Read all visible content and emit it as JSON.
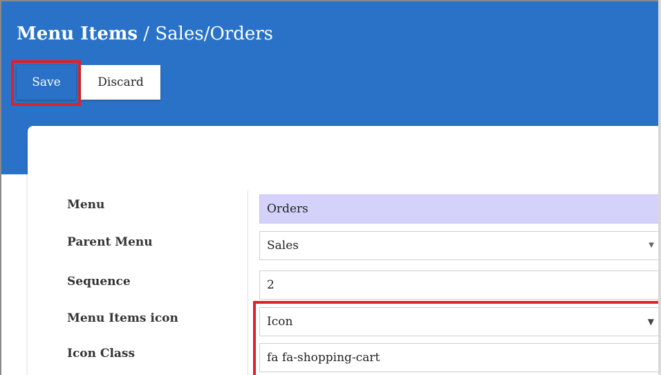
{
  "header": {
    "title_model": "Menu Items",
    "title_separator": " / ",
    "title_record": "Sales/Orders"
  },
  "toolbar": {
    "save_label": "Save",
    "discard_label": "Discard"
  },
  "form": {
    "menu": {
      "label": "Menu",
      "value": "Orders"
    },
    "parent_menu": {
      "label": "Parent Menu",
      "value": "Sales"
    },
    "sequence": {
      "label": "Sequence",
      "value": "2"
    },
    "menu_items_icon": {
      "label": "Menu Items icon",
      "value": "Icon"
    },
    "icon_class": {
      "label": "Icon Class",
      "value": "fa fa-shopping-cart"
    }
  },
  "colors": {
    "header_bg": "#2a72c8",
    "highlight": "#e0202a",
    "readonly_bg": "#d4d2fb"
  },
  "icons": {
    "parent_menu_dropdown": "caret-down-icon",
    "menu_items_icon_dropdown": "caret-down-icon"
  }
}
